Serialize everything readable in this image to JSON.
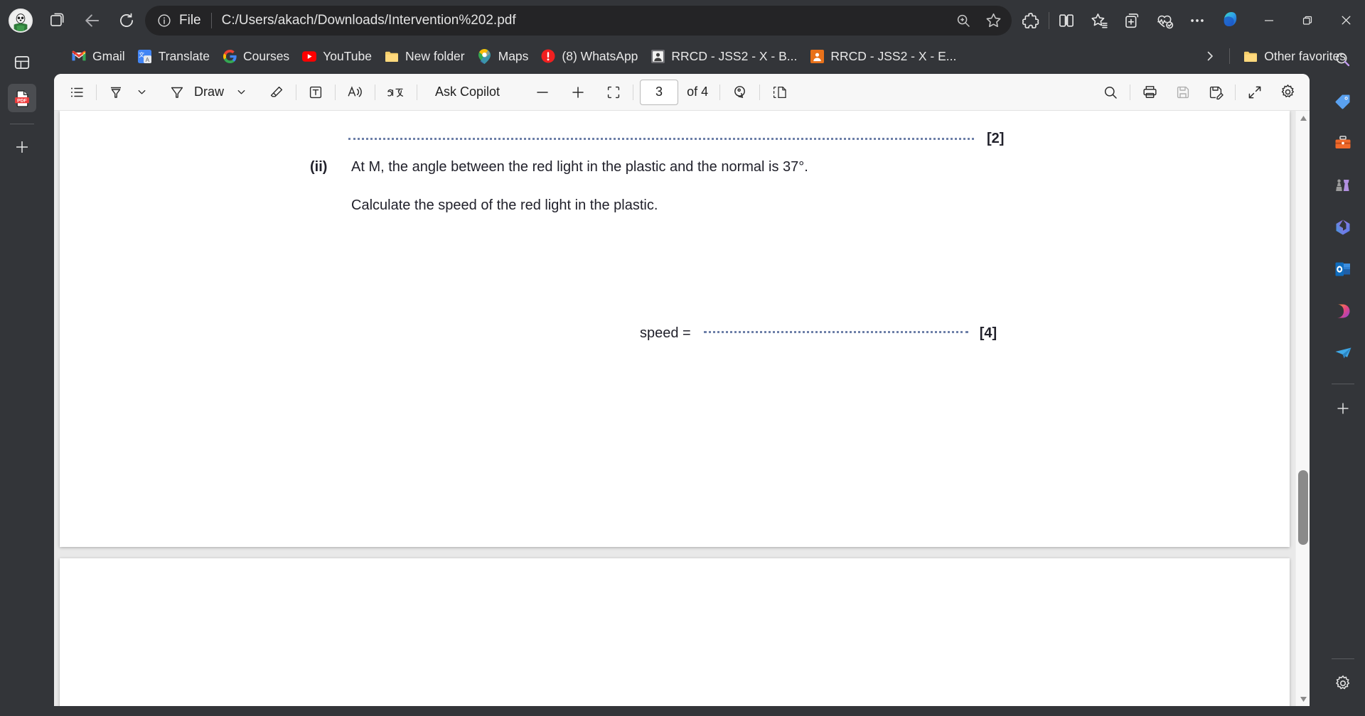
{
  "browser": {
    "titlebar": {
      "avatar_name": "profile-avatar",
      "back_icon": "back-arrow-icon",
      "reload_icon": "reload-icon",
      "collections_icon": "browser-essentials-icon",
      "file_label": "File",
      "url": "C:/Users/akach/Downloads/Intervention%202.pdf",
      "zoom_icon": "zoom-in-icon",
      "favorite_icon": "star-icon",
      "extensions_icon": "extensions-icon",
      "split_screen_icon": "split-screen-icon",
      "favorites_list_icon": "favorites-icon",
      "collections_add_icon": "collections-icon",
      "browser_essentials_icon": "browser-essentials-health-icon",
      "settings_more_icon": "more-options-icon",
      "copilot_icon": "copilot-icon",
      "minimize_icon": "minimize-icon",
      "maximize_icon": "restore-icon",
      "close_icon": "close-icon"
    },
    "bookmarks": {
      "items": [
        {
          "label": "Gmail",
          "icon": "gmail-icon"
        },
        {
          "label": "Translate",
          "icon": "google-translate-icon"
        },
        {
          "label": "Courses",
          "icon": "google-icon"
        },
        {
          "label": "YouTube",
          "icon": "youtube-icon"
        },
        {
          "label": "New folder",
          "icon": "folder-icon"
        },
        {
          "label": "Maps",
          "icon": "google-maps-icon"
        },
        {
          "label": "(8) WhatsApp",
          "icon": "whatsapp-alert-icon"
        },
        {
          "label": "RRCD - JSS2 - X - B...",
          "icon": "contact-gray-icon"
        },
        {
          "label": "RRCD - JSS2 - X - E...",
          "icon": "contact-orange-icon"
        }
      ],
      "overflow_icon": "chevron-right-icon",
      "other_favorites": {
        "label": "Other favorites",
        "icon": "folder-icon"
      }
    },
    "left_rail": {
      "items": [
        {
          "name": "tab-actions-icon",
          "active": false
        },
        {
          "name": "pdf-tab-icon",
          "active": true
        },
        {
          "name": "new-tab-plus-icon",
          "active": false
        }
      ]
    },
    "right_rail": {
      "items": [
        {
          "name": "search-sidebar-icon"
        },
        {
          "name": "shopping-tag-icon"
        },
        {
          "name": "tools-toolbox-icon"
        },
        {
          "name": "games-chess-icon"
        },
        {
          "name": "microsoft-365-icon"
        },
        {
          "name": "outlook-icon"
        },
        {
          "name": "designer-icon"
        },
        {
          "name": "telegram-icon"
        },
        {
          "name": "add-sidebar-plus-icon"
        },
        {
          "name": "sidebar-settings-gear-icon"
        }
      ]
    }
  },
  "pdf_toolbar": {
    "table_of_contents_label": "table-of-contents-icon",
    "highlight_label": "highlight-icon",
    "highlight_chevron": "chevron-down-icon",
    "draw_label": "Draw",
    "draw_chevron": "chevron-down-icon",
    "erase_label": "erase-icon",
    "text_label": "add-text-icon",
    "read_aloud_label": "read-aloud-icon",
    "translate_label": "translate-icon",
    "ask_copilot_label": "Ask Copilot",
    "zoom_out_label": "zoom-out-icon",
    "zoom_in_label": "zoom-in-icon",
    "fit_page_label": "fit-to-page-icon",
    "page_number": "3",
    "page_of": "of 4",
    "rotate_label": "rotate-icon",
    "page_view_label": "page-view-icon",
    "search_label": "search-icon",
    "print_label": "print-icon",
    "save_label": "save-icon",
    "save_as_label": "save-as-icon",
    "fullscreen_label": "fullscreen-icon",
    "settings_label": "settings-gear-icon"
  },
  "document": {
    "page_3": {
      "answer_line_1_marks": "[2]",
      "question_ii_marker": "(ii)",
      "question_ii_text": "At M, the angle between the red light in the plastic and the normal is 37°.",
      "question_ii_instruction": "Calculate the speed of the red light in the plastic.",
      "answer_label": "speed =",
      "answer_marks": "[4]"
    }
  },
  "scrollbar": {
    "up_arrow": "scroll-up-arrow-icon",
    "down_arrow": "scroll-down-arrow-icon",
    "thumb": "scroll-thumb"
  },
  "colors": {
    "chrome_bg": "#333539",
    "addressbar_bg": "#242426",
    "toolbar_bg": "#f7f7f7",
    "page_bg": "#ffffff",
    "dotted_line": "#6d7fa8",
    "accent_blue": "#0f6cbd"
  }
}
